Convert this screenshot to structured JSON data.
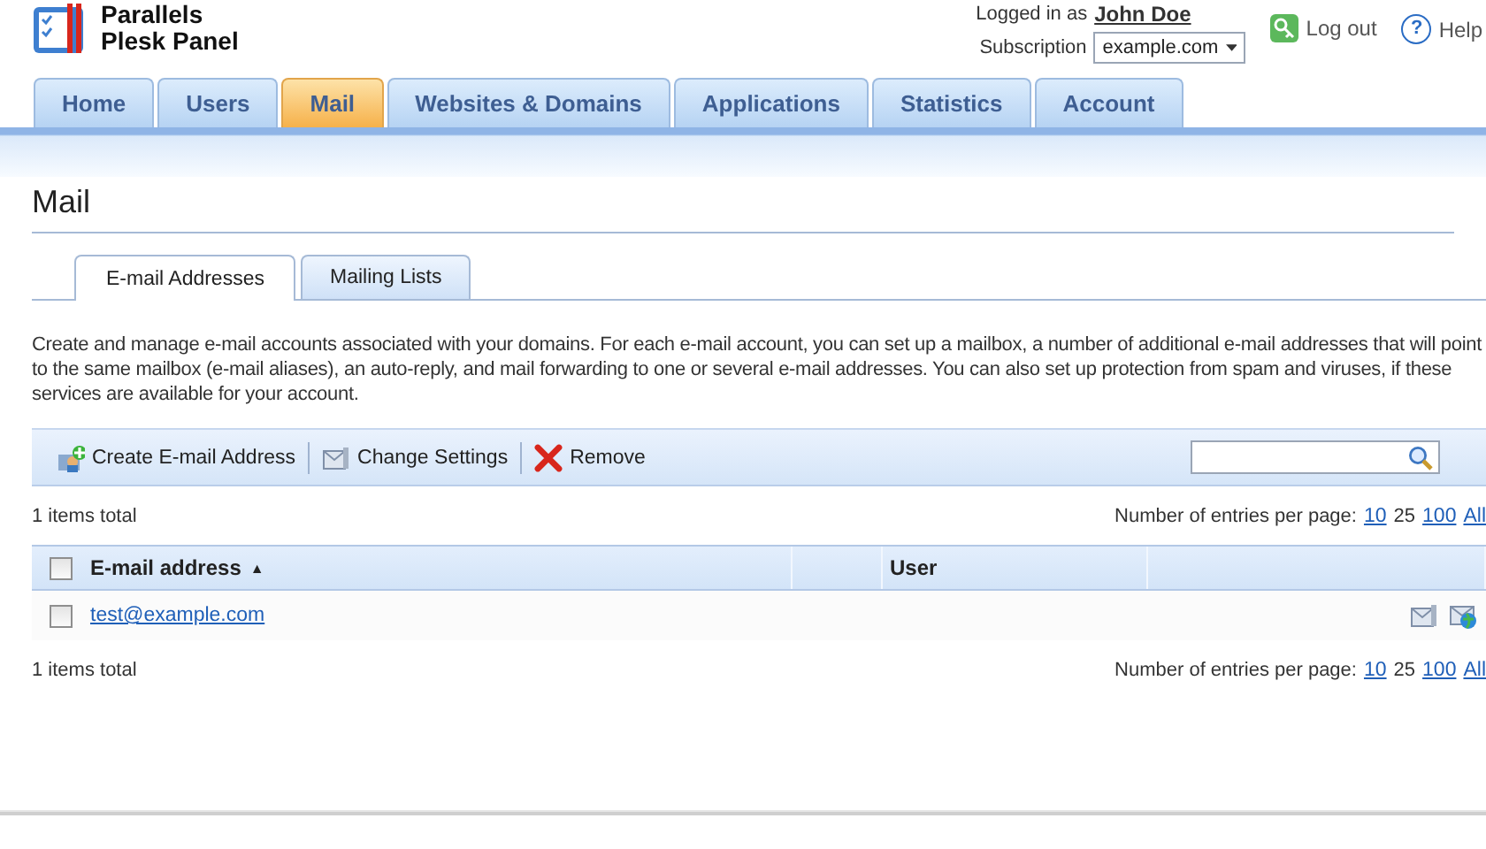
{
  "logo": {
    "line_1": "Parallels",
    "line_2": "Plesk Panel"
  },
  "account": {
    "logged_in_label": "Logged in as",
    "user_name": "John Doe",
    "subscription_label": "Subscription",
    "subscription_value": "example.com",
    "logout": "Log out",
    "help_glyph": "?",
    "help": "Help"
  },
  "tabs": [
    {
      "label": "Home",
      "selected": false
    },
    {
      "label": "Users",
      "selected": false
    },
    {
      "label": "Mail",
      "selected": true
    },
    {
      "label": "Websites & Domains",
      "selected": false
    },
    {
      "label": "Applications",
      "selected": false
    },
    {
      "label": "Statistics",
      "selected": false
    },
    {
      "label": "Account",
      "selected": false
    }
  ],
  "page_title": "Mail",
  "subtabs": [
    {
      "label": "E-mail Addresses",
      "selected": true
    },
    {
      "label": "Mailing Lists",
      "selected": false
    }
  ],
  "description": "Create and manage e-mail accounts associated with your domains. For each e-mail account, you can set up a mailbox, a number of additional e-mail addresses that will point to the same mailbox (e-mail aliases), an auto-reply, and mail forwarding to one or several e-mail addresses. You can also set up protection from spam and viruses, if these services are available for your account.",
  "toolbar": [
    {
      "kind": "create",
      "label": "Create E-mail Address"
    },
    {
      "kind": "settings",
      "label": "Change Settings"
    },
    {
      "kind": "remove",
      "label": "Remove"
    }
  ],
  "pager_top": {
    "total": "1 items total",
    "entries_label": "Number of entries per page:",
    "page_sizes": [
      {
        "label": "10",
        "selected": false
      },
      {
        "label": "25",
        "selected": true
      },
      {
        "label": "100",
        "selected": false
      },
      {
        "label": "All",
        "selected": false
      }
    ]
  },
  "table": {
    "columns": [
      {
        "label": "E-mail address",
        "sort_glyph": "▲"
      },
      {},
      {
        "label": "User"
      }
    ],
    "rows": [
      {
        "checked": false,
        "email": "test@example.com"
      }
    ]
  },
  "select_all": {
    "checked": false
  },
  "pager_bottom": {
    "total": "1 items total",
    "entries_label": "Number of entries per page:",
    "page_sizes": [
      {
        "label": "10",
        "selected": false
      },
      {
        "label": "25",
        "selected": true
      },
      {
        "label": "100",
        "selected": false
      },
      {
        "label": "All",
        "selected": false
      }
    ]
  }
}
